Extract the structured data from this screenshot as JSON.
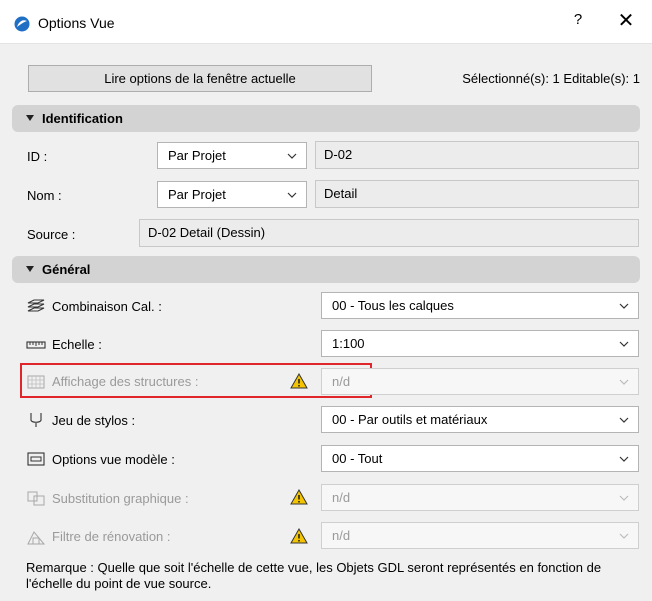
{
  "window": {
    "title": "Options Vue",
    "help_label": "?",
    "close_label": "✕"
  },
  "toolbar": {
    "read_button_label": "Lire options de la fenêtre actuelle",
    "selection_info": "Sélectionné(s): 1 Editable(s): 1"
  },
  "identification": {
    "header": "Identification",
    "id": {
      "label": "ID :",
      "mode": "Par Projet",
      "value": "D-02"
    },
    "name": {
      "label": "Nom :",
      "mode": "Par Projet",
      "value": "Detail"
    },
    "source": {
      "label": "Source :",
      "value": "D-02 Detail (Dessin)"
    }
  },
  "general": {
    "header": "Général",
    "layer_combo": {
      "label": "Combinaison Cal. :",
      "value": "00 - Tous les calques",
      "icon": "layers-icon"
    },
    "scale": {
      "label": "Echelle :",
      "value": "1:100",
      "icon": "ruler-icon"
    },
    "structure_display": {
      "label": "Affichage des structures :",
      "value": "n/d",
      "icon": "structure-icon",
      "warning": true
    },
    "pen_set": {
      "label": "Jeu de stylos :",
      "value": "00 - Par outils et matériaux",
      "icon": "pen-icon"
    },
    "model_view_options": {
      "label": "Options vue modèle :",
      "value": "00 - Tout",
      "icon": "model-view-icon"
    },
    "graphic_override": {
      "label": "Substitution graphique :",
      "value": "n/d",
      "icon": "graphic-override-icon",
      "warning": true
    },
    "renovation_filter": {
      "label": "Filtre de rénovation :",
      "value": "n/d",
      "icon": "renovation-icon",
      "warning": true
    }
  },
  "remark": "Remarque : Quelle que soit l'échelle de cette vue, les Objets GDL seront représentés en fonction de l'échelle du point de vue source.",
  "colors": {
    "highlight": "#e0262a",
    "warning": "#f5c400",
    "section_bg": "#d3d3d3"
  }
}
